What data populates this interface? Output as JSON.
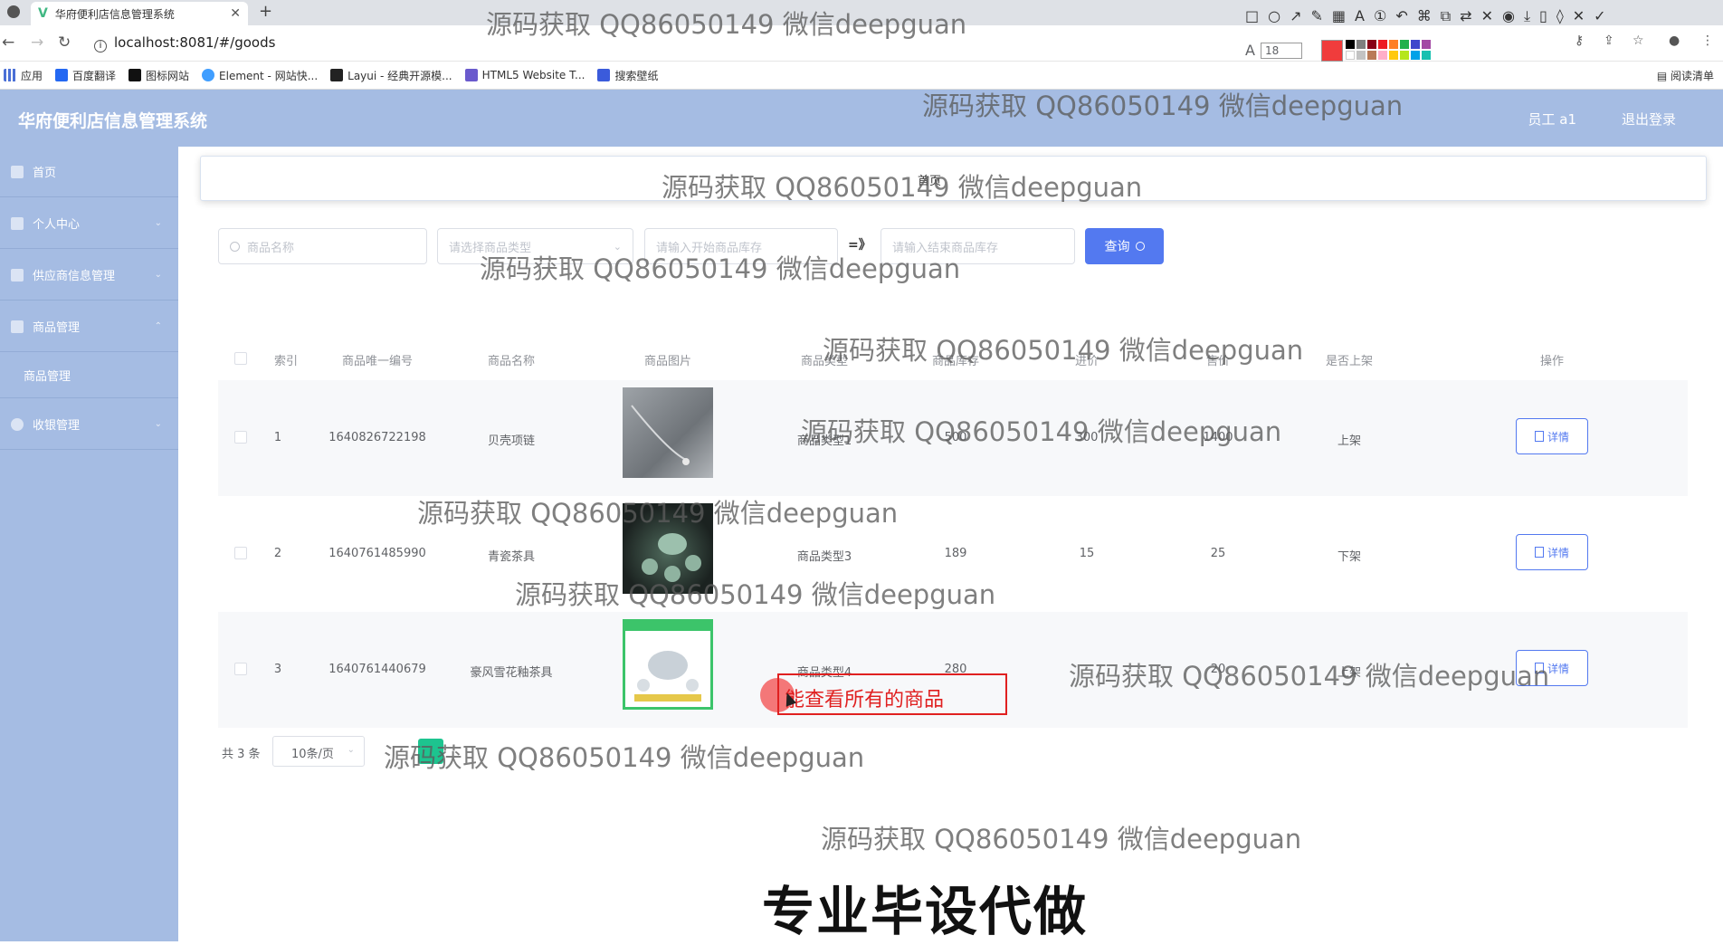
{
  "browser": {
    "tab_title": "华府便利店信息管理系统",
    "url": "localhost:8081/#/goods",
    "bookmarks": [
      "应用",
      "百度翻译",
      "图标网站",
      "Element - 网站快...",
      "Layui - 经典开源模...",
      "HTML5 Website T...",
      "搜索壁纸"
    ],
    "reading_list": "阅读清单",
    "font_size_value": "18"
  },
  "header": {
    "title": "华府便利店信息管理系统",
    "user": "员工 a1",
    "logout": "退出登录"
  },
  "sidebar": {
    "items": [
      {
        "label": "首页"
      },
      {
        "label": "个人中心"
      },
      {
        "label": "供应商信息管理"
      },
      {
        "label": "商品管理"
      },
      {
        "label": "商品管理"
      },
      {
        "label": "收银管理"
      }
    ]
  },
  "breadcrumb": {
    "label": "首页"
  },
  "filters": {
    "name_placeholder": "商品名称",
    "type_placeholder": "请选择商品类型",
    "stock_start_placeholder": "请输入开始商品库存",
    "range_arrow": "=》",
    "stock_end_placeholder": "请输入结束商品库存",
    "query_label": "查询"
  },
  "table": {
    "headers": [
      "索引",
      "商品唯一编号",
      "商品名称",
      "商品图片",
      "商品类型",
      "商品库存",
      "进价",
      "售价",
      "是否上架",
      "操作"
    ],
    "rows": [
      {
        "index": "1",
        "code": "1640826722198",
        "name": "贝壳项链",
        "type": "商品类型1",
        "stock": "500",
        "buy": "300",
        "sell": "1400",
        "on_sale": "上架",
        "action": "详情"
      },
      {
        "index": "2",
        "code": "1640761485990",
        "name": "青瓷茶具",
        "type": "商品类型3",
        "stock": "189",
        "buy": "15",
        "sell": "25",
        "on_sale": "下架",
        "action": "详情"
      },
      {
        "index": "3",
        "code": "1640761440679",
        "name": "豪风雪花釉茶具",
        "type": "商品类型4",
        "stock": "280",
        "buy": "",
        "sell": "20",
        "on_sale": "上架",
        "action": "详情"
      }
    ]
  },
  "pagination": {
    "total": "共 3 条",
    "page_size": "10条/页"
  },
  "annotation": {
    "text": "能查看所有的商品"
  },
  "watermarks": {
    "text": "源码获取 QQ86050149 微信deepguan",
    "bottom_banner": "专业毕设代做"
  },
  "colors": {
    "header_bg": "#a5bce3",
    "accent": "#5379f0",
    "annotation": "#e02020"
  }
}
